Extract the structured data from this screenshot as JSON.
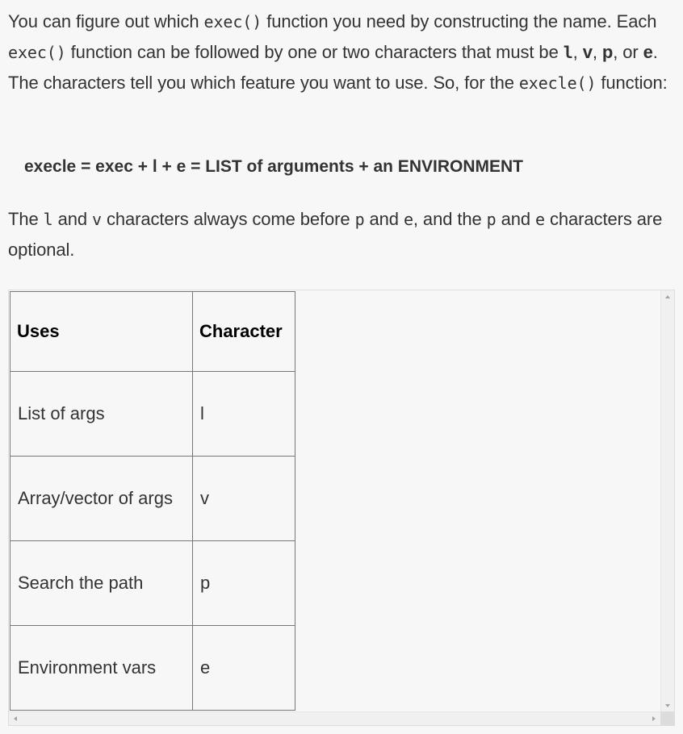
{
  "intro": {
    "t1": "You can figure out which ",
    "code_exec": "exec()",
    "t2": " function you need by constructing the name. Each ",
    "code_exec2": "exec()",
    "t3": " function can be followed by one or two characters that must be ",
    "char_l": "l",
    "sep1": ", ",
    "char_v": "v",
    "sep2": ", ",
    "char_p": "p",
    "sep3": ", or ",
    "char_e": "e",
    "t4": ". The characters tell you which feature you want to use. So, for the ",
    "code_execle": "execle()",
    "t5": " function:"
  },
  "formula": "execle = exec + l + e = LIST of arguments + an ENVIRONMENT",
  "order_note": {
    "t1": "The ",
    "c1": "l",
    "t2": " and ",
    "c2": "v",
    "t3": " characters always come before ",
    "c3": "p",
    "t4": " and ",
    "c4": "e",
    "t5": ", and the ",
    "c5": "p",
    "t6": " and ",
    "c6": "e",
    "t7": " characters are optional."
  },
  "table": {
    "headers": [
      "Uses",
      "Character"
    ],
    "rows": [
      [
        "List of args",
        "l"
      ],
      [
        "Array/vector of args",
        "v"
      ],
      [
        "Search the path",
        "p"
      ],
      [
        "Environment vars",
        "e"
      ]
    ]
  },
  "icons": {
    "scroll_up": "triangle-up-icon",
    "scroll_down": "triangle-down-icon",
    "scroll_left": "triangle-left-icon",
    "scroll_right": "triangle-right-icon"
  }
}
